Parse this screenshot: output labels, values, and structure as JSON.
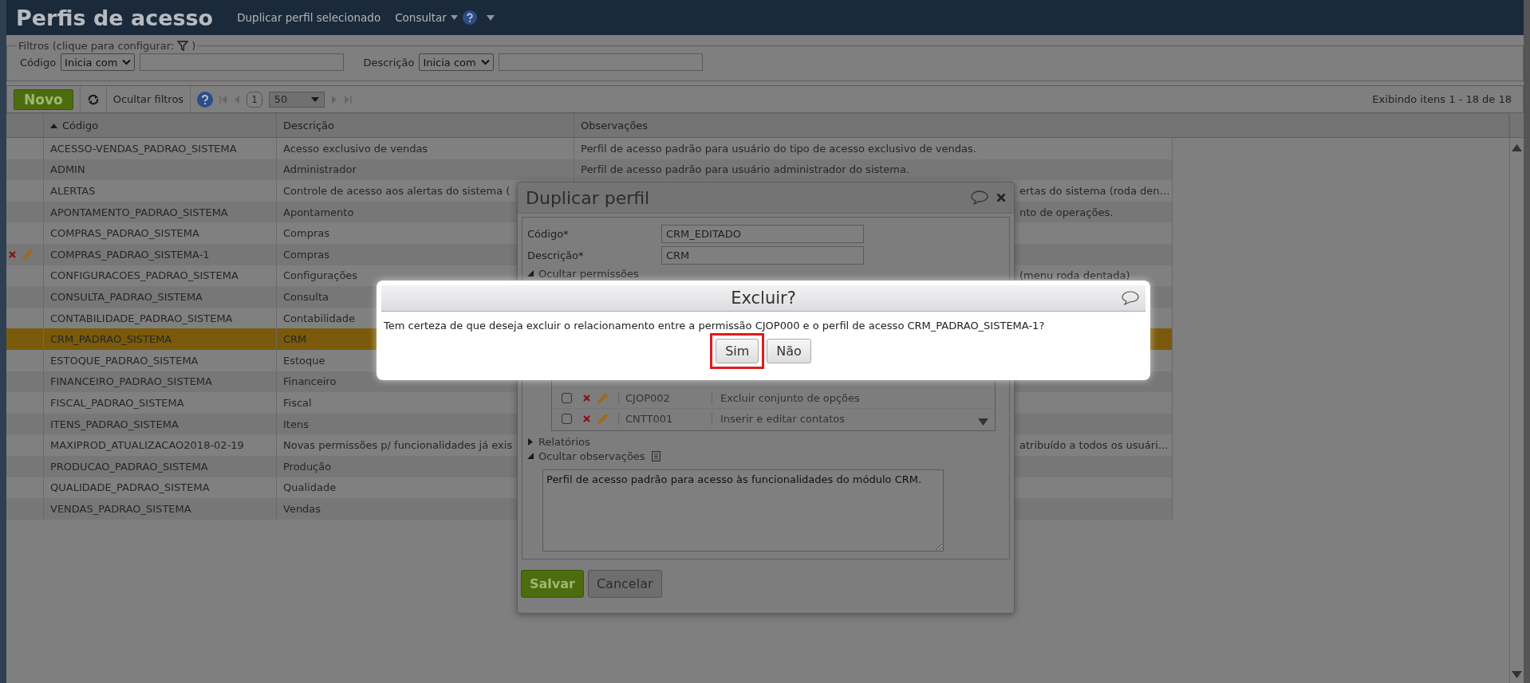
{
  "header": {
    "title": "Perfis de acesso",
    "actions": [
      {
        "label": "Duplicar perfil selecionado",
        "kind": "link"
      },
      {
        "label": "Consultar",
        "kind": "menu"
      }
    ]
  },
  "filters": {
    "legend": "Filtros (clique para configurar:",
    "legend_end": ")",
    "fields": [
      {
        "label": "Código",
        "operator": "Inicia com"
      },
      {
        "label": "Descrição",
        "operator": "Inicia com"
      }
    ]
  },
  "toolbar": {
    "new_button": "Novo",
    "hide_filters": "Ocultar filtros",
    "page": "1",
    "page_size": "50",
    "summary": "Exibindo itens 1 - 18 de 18"
  },
  "table": {
    "columns": [
      {
        "label": "Código",
        "sorted": true
      },
      {
        "label": "Descrição",
        "sorted": false
      },
      {
        "label": "Observações",
        "sorted": false
      }
    ],
    "rows": [
      {
        "code": "ACESSO-VENDAS_PADRAO_SISTEMA",
        "description": "Acesso exclusivo de vendas",
        "observation": "Perfil de acesso padrão para usuário do tipo de acesso exclusivo de vendas.",
        "selected": false,
        "show_actions": false,
        "obs_behind_dialog": false
      },
      {
        "code": "ADMIN",
        "description": "Administrador",
        "observation": "Perfil de acesso padrão para usuário administrador do sistema.",
        "selected": false,
        "show_actions": false,
        "obs_behind_dialog": false
      },
      {
        "code": "ALERTAS",
        "description": "Controle de acesso aos alertas do sistema (",
        "observation": "ertas do sistema (roda den…",
        "selected": false,
        "show_actions": false,
        "obs_behind_dialog": true
      },
      {
        "code": "APONTAMENTO_PADRAO_SISTEMA",
        "description": "Apontamento",
        "observation": "nto de operações.",
        "selected": false,
        "show_actions": false,
        "obs_behind_dialog": true
      },
      {
        "code": "COMPRAS_PADRAO_SISTEMA",
        "description": "Compras",
        "selected": false,
        "show_actions": false
      },
      {
        "code": "COMPRAS_PADRAO_SISTEMA-1",
        "description": "Compras",
        "selected": false,
        "show_actions": true
      },
      {
        "code": "CONFIGURACOES_PADRAO_SISTEMA",
        "description": "Configurações",
        "observation": "(menu roda dentada)",
        "selected": false,
        "show_actions": false,
        "obs_behind_dialog": true
      },
      {
        "code": "CONSULTA_PADRAO_SISTEMA",
        "description": "Consulta",
        "selected": false,
        "show_actions": false
      },
      {
        "code": "CONTABILIDADE_PADRAO_SISTEMA",
        "description": "Contabilidade",
        "selected": false,
        "show_actions": false
      },
      {
        "code": "CRM_PADRAO_SISTEMA",
        "description": "CRM",
        "selected": true,
        "show_actions": false
      },
      {
        "code": "ESTOQUE_PADRAO_SISTEMA",
        "description": "Estoque",
        "selected": false,
        "show_actions": false
      },
      {
        "code": "FINANCEIRO_PADRAO_SISTEMA",
        "description": "Financeiro",
        "selected": false,
        "show_actions": false
      },
      {
        "code": "FISCAL_PADRAO_SISTEMA",
        "description": "Fiscal",
        "selected": false,
        "show_actions": false
      },
      {
        "code": "ITENS_PADRAO_SISTEMA",
        "description": "Itens",
        "selected": false,
        "show_actions": false
      },
      {
        "code": "MAXIPROD_ATUALIZACAO2018-02-19",
        "description": "Novas permissões p/ funcionalidades já exis",
        "observation": "atribuído a todos os usuári…",
        "selected": false,
        "show_actions": false,
        "obs_behind_dialog": true
      },
      {
        "code": "PRODUCAO_PADRAO_SISTEMA",
        "description": "Produção",
        "selected": false,
        "show_actions": false
      },
      {
        "code": "QUALIDADE_PADRAO_SISTEMA",
        "description": "Qualidade",
        "selected": false,
        "show_actions": false
      },
      {
        "code": "VENDAS_PADRAO_SISTEMA",
        "description": "Vendas",
        "selected": false,
        "show_actions": false
      }
    ]
  },
  "dialog": {
    "title": "Duplicar perfil",
    "fields": [
      {
        "label": "Código*",
        "value": "CRM_EDITADO"
      },
      {
        "label": "Descrição*",
        "value": "CRM"
      }
    ],
    "permissions_toggle": {
      "label": "Ocultar permissões",
      "expanded": true
    },
    "permissions": [
      {
        "code": "CJOP002",
        "description": "Excluir conjunto de opções",
        "checked": false
      },
      {
        "code": "CNTT001",
        "description": "Inserir e editar contatos",
        "checked": false
      }
    ],
    "reports_toggle": {
      "label": "Relatórios",
      "expanded": false
    },
    "notes_toggle": {
      "label": "Ocultar observações",
      "expanded": true
    },
    "notes": "Perfil de acesso padrão para acesso às funcionalidades do módulo CRM.",
    "buttons": [
      {
        "label": "Salvar",
        "kind": "primary"
      },
      {
        "label": "Cancelar",
        "kind": "secondary"
      }
    ]
  },
  "confirm": {
    "title": "Excluir?",
    "message": "Tem certeza de que deseja excluir o relacionamento entre a permissão CJOP000 e o perfil de acesso CRM_PADRAO_SISTEMA-1?",
    "buttons": [
      {
        "label": "Sim",
        "highlighted": true
      },
      {
        "label": "Não",
        "highlighted": false
      }
    ]
  }
}
